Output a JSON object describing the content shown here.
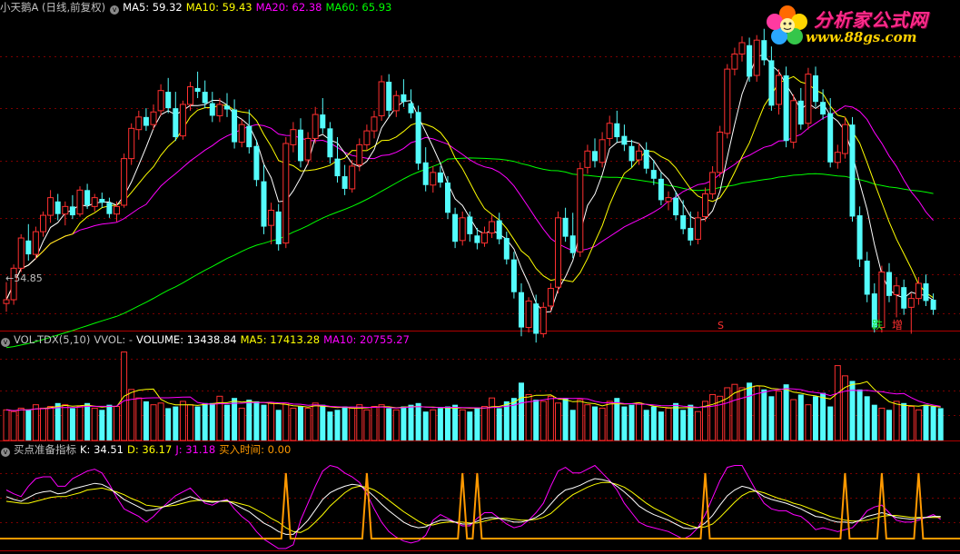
{
  "main_header": {
    "title": "小天鹅A (日线,前复权)",
    "ma5": "MA5: 59.32",
    "ma10": "MA10: 59.43",
    "ma20": "MA20: 62.38",
    "ma60": "MA60: 65.93"
  },
  "vol_header": {
    "name": "VOL-TDX(5,10)",
    "vvol": "VVOL: -",
    "volume": "VOLUME: 13438.84",
    "ma5": "MA5: 17413.28",
    "ma10": "MA10: 20755.27"
  },
  "kdj_header": {
    "name": "买点准备指标",
    "k": "K: 34.51",
    "d": "D: 36.17",
    "j": "J: 31.18",
    "buy": "买入时间: 0.00"
  },
  "low_marker": "54.85",
  "signals": {
    "s_label": "S",
    "die_label": "跌",
    "zeng_label": "增"
  },
  "logo": {
    "title": "分析家公式网",
    "url": "www.88gs.com"
  },
  "colors": {
    "up": "#ff3030",
    "down": "#54fcfc",
    "ma5": "#ffffff",
    "ma10": "#ffff00",
    "ma20": "#ff00ff",
    "ma60": "#00ff00",
    "grid": "#7a0000",
    "buy_line": "#ff9900"
  },
  "chart_data": [
    {
      "type": "candlestick",
      "title": "小天鹅A (日线,前复权)",
      "series_names": [
        "MA5",
        "MA10",
        "MA20",
        "MA60"
      ],
      "annotations": [
        "54.85"
      ],
      "candles": [
        [
          55.5,
          57.2,
          54.85,
          55.8
        ],
        [
          55.8,
          58.6,
          55.4,
          58.3
        ],
        [
          58.3,
          61.0,
          58.0,
          60.7
        ],
        [
          60.5,
          61.8,
          58.9,
          59.4
        ],
        [
          59.4,
          61.6,
          59.0,
          61.2
        ],
        [
          61.2,
          62.8,
          60.8,
          62.5
        ],
        [
          62.5,
          64.5,
          61.9,
          63.9
        ],
        [
          63.6,
          64.2,
          62.1,
          62.6
        ],
        [
          62.6,
          63.6,
          61.7,
          63.2
        ],
        [
          63.2,
          64.1,
          62.2,
          62.5
        ],
        [
          62.6,
          64.8,
          62.4,
          64.5
        ],
        [
          64.5,
          65.0,
          63.0,
          63.3
        ],
        [
          63.2,
          64.2,
          62.8,
          63.9
        ],
        [
          63.8,
          64.3,
          63.1,
          63.5
        ],
        [
          63.5,
          63.9,
          62.3,
          62.6
        ],
        [
          62.6,
          63.6,
          62.0,
          63.2
        ],
        [
          63.3,
          67.4,
          63.1,
          67.0
        ],
        [
          67.0,
          69.8,
          66.5,
          69.4
        ],
        [
          69.3,
          70.8,
          68.5,
          70.3
        ],
        [
          70.3,
          71.0,
          69.2,
          69.6
        ],
        [
          69.7,
          71.3,
          69.3,
          70.7
        ],
        [
          70.8,
          72.9,
          70.4,
          72.4
        ],
        [
          72.3,
          73.4,
          70.6,
          71.0
        ],
        [
          71.0,
          72.3,
          68.4,
          68.7
        ],
        [
          68.8,
          71.6,
          68.5,
          71.3
        ],
        [
          71.3,
          73.1,
          70.8,
          72.7
        ],
        [
          72.6,
          73.9,
          71.8,
          72.3
        ],
        [
          72.3,
          73.2,
          71.0,
          71.4
        ],
        [
          71.4,
          72.3,
          69.9,
          70.4
        ],
        [
          70.4,
          71.8,
          69.9,
          71.3
        ],
        [
          71.2,
          72.2,
          70.3,
          70.9
        ],
        [
          70.9,
          71.7,
          67.8,
          68.3
        ],
        [
          68.3,
          70.1,
          67.9,
          69.7
        ],
        [
          69.6,
          70.9,
          67.4,
          67.9
        ],
        [
          68.0,
          68.5,
          64.8,
          65.3
        ],
        [
          65.2,
          66.5,
          61.0,
          61.6
        ],
        [
          61.7,
          63.5,
          60.2,
          62.9
        ],
        [
          62.8,
          63.4,
          59.7,
          60.2
        ],
        [
          60.3,
          68.7,
          59.9,
          68.2
        ],
        [
          68.1,
          69.9,
          67.5,
          69.3
        ],
        [
          69.3,
          70.2,
          66.3,
          66.8
        ],
        [
          66.9,
          69.1,
          66.5,
          68.6
        ],
        [
          68.6,
          71.1,
          68.2,
          70.5
        ],
        [
          70.5,
          71.8,
          69.0,
          69.4
        ],
        [
          69.4,
          69.9,
          66.6,
          67.1
        ],
        [
          67.0,
          68.7,
          65.1,
          65.6
        ],
        [
          65.6,
          66.5,
          64.1,
          64.6
        ],
        [
          64.6,
          66.9,
          64.3,
          66.4
        ],
        [
          66.5,
          68.6,
          66.0,
          68.1
        ],
        [
          68.1,
          69.7,
          67.7,
          69.2
        ],
        [
          69.2,
          70.8,
          68.6,
          70.3
        ],
        [
          70.4,
          73.6,
          70.0,
          73.1
        ],
        [
          73.1,
          73.7,
          70.3,
          70.8
        ],
        [
          70.8,
          72.4,
          70.3,
          72.0
        ],
        [
          72.1,
          73.3,
          71.1,
          71.5
        ],
        [
          71.4,
          72.5,
          70.2,
          70.6
        ],
        [
          70.7,
          71.2,
          66.1,
          66.6
        ],
        [
          66.7,
          67.9,
          64.4,
          64.9
        ],
        [
          64.9,
          66.4,
          64.3,
          65.9
        ],
        [
          65.9,
          66.4,
          64.7,
          65.1
        ],
        [
          65.1,
          65.6,
          62.2,
          62.7
        ],
        [
          62.6,
          63.1,
          59.9,
          60.4
        ],
        [
          60.5,
          62.8,
          60.1,
          62.3
        ],
        [
          62.4,
          62.8,
          60.4,
          61.0
        ],
        [
          60.9,
          61.5,
          59.8,
          60.3
        ],
        [
          60.3,
          61.6,
          60.0,
          61.1
        ],
        [
          61.1,
          62.5,
          60.7,
          62.0
        ],
        [
          62.1,
          62.7,
          60.2,
          60.6
        ],
        [
          60.7,
          61.2,
          58.6,
          59.0
        ],
        [
          59.0,
          59.6,
          55.9,
          56.4
        ],
        [
          56.4,
          57.1,
          52.9,
          53.6
        ],
        [
          53.6,
          56.0,
          53.2,
          55.7
        ],
        [
          55.5,
          56.2,
          52.4,
          53.1
        ],
        [
          53.1,
          55.6,
          52.8,
          55.2
        ],
        [
          55.3,
          57.1,
          54.9,
          56.7
        ],
        [
          56.8,
          62.8,
          56.3,
          62.3
        ],
        [
          62.3,
          63.1,
          60.4,
          60.8
        ],
        [
          60.9,
          62.7,
          59.1,
          59.5
        ],
        [
          59.6,
          66.7,
          59.2,
          66.2
        ],
        [
          66.3,
          68.1,
          65.8,
          67.6
        ],
        [
          67.6,
          68.6,
          66.3,
          66.8
        ],
        [
          66.7,
          69.1,
          66.3,
          68.5
        ],
        [
          68.6,
          70.4,
          68.0,
          69.8
        ],
        [
          69.8,
          70.8,
          68.3,
          68.7
        ],
        [
          68.8,
          69.7,
          67.6,
          68.1
        ],
        [
          68.0,
          68.5,
          66.3,
          66.8
        ],
        [
          66.9,
          68.2,
          66.5,
          67.6
        ],
        [
          67.7,
          68.3,
          65.8,
          66.2
        ],
        [
          66.1,
          66.9,
          64.9,
          65.4
        ],
        [
          65.4,
          65.9,
          63.3,
          63.7
        ],
        [
          63.6,
          64.4,
          62.9,
          63.9
        ],
        [
          63.9,
          64.4,
          62.1,
          62.5
        ],
        [
          62.5,
          63.7,
          61.0,
          61.4
        ],
        [
          61.5,
          62.8,
          60.1,
          60.5
        ],
        [
          60.6,
          62.8,
          60.2,
          62.3
        ],
        [
          62.4,
          64.7,
          62.0,
          64.2
        ],
        [
          64.2,
          66.4,
          63.8,
          65.9
        ],
        [
          65.9,
          69.6,
          65.5,
          69.1
        ],
        [
          69.0,
          74.5,
          68.6,
          74.1
        ],
        [
          74.1,
          75.8,
          73.6,
          75.3
        ],
        [
          75.3,
          76.7,
          74.7,
          76.2
        ],
        [
          76.0,
          76.6,
          73.1,
          73.5
        ],
        [
          73.6,
          76.8,
          73.1,
          76.4
        ],
        [
          76.4,
          77.3,
          74.4,
          74.8
        ],
        [
          74.8,
          75.9,
          70.8,
          71.2
        ],
        [
          71.3,
          74.1,
          70.5,
          73.6
        ],
        [
          73.6,
          74.3,
          67.9,
          68.4
        ],
        [
          68.3,
          72.1,
          67.8,
          71.6
        ],
        [
          71.6,
          72.6,
          69.3,
          69.7
        ],
        [
          69.8,
          74.2,
          69.3,
          73.7
        ],
        [
          73.6,
          74.3,
          71.1,
          71.5
        ],
        [
          71.5,
          72.5,
          70.1,
          70.5
        ],
        [
          70.6,
          71.8,
          66.3,
          66.7
        ],
        [
          66.7,
          68.1,
          66.2,
          67.5
        ],
        [
          67.4,
          70.3,
          67.0,
          69.7
        ],
        [
          69.7,
          70.3,
          62.0,
          62.4
        ],
        [
          62.5,
          63.2,
          58.4,
          59.0
        ],
        [
          58.9,
          59.6,
          55.6,
          56.2
        ],
        [
          56.3,
          57.1,
          53.2,
          53.6
        ],
        [
          53.6,
          58.5,
          53.2,
          58.0
        ],
        [
          58.0,
          58.7,
          55.6,
          56.1
        ],
        [
          56.2,
          57.6,
          54.4,
          56.9
        ],
        [
          56.8,
          57.4,
          54.6,
          55.1
        ],
        [
          55.2,
          56.3,
          53.1,
          55.9
        ],
        [
          55.9,
          57.6,
          55.4,
          57.1
        ],
        [
          57.1,
          57.8,
          55.3,
          55.7
        ],
        [
          55.8,
          56.3,
          54.6,
          55.0
        ]
      ],
      "ylim": [
        54,
        78
      ]
    },
    {
      "type": "bar",
      "title": "VOL-TDX(5,10)",
      "series_names": [
        "VOLUME",
        "MA5",
        "MA10"
      ],
      "values": [
        18,
        17,
        19,
        18,
        21,
        19,
        20,
        22,
        21,
        19,
        20,
        22,
        19,
        18,
        21,
        20,
        52,
        30,
        25,
        23,
        21,
        22,
        19,
        20,
        23,
        21,
        20,
        22,
        22,
        26,
        21,
        25,
        19,
        24,
        23,
        21,
        22,
        18,
        22,
        19,
        20,
        19,
        22,
        21,
        17,
        18,
        20,
        19,
        21,
        18,
        20,
        21,
        19,
        18,
        20,
        21,
        22,
        17,
        18,
        19,
        20,
        21,
        18,
        17,
        19,
        20,
        25,
        19,
        23,
        25,
        34,
        27,
        24,
        23,
        26,
        22,
        25,
        18,
        24,
        21,
        20,
        19,
        23,
        25,
        20,
        21,
        22,
        18,
        20,
        17,
        19,
        22,
        18,
        21,
        17,
        23,
        27,
        26,
        31,
        33,
        31,
        34,
        32,
        30,
        26,
        29,
        33,
        24,
        27,
        21,
        26,
        28,
        20,
        44,
        38,
        35,
        30,
        26,
        21,
        19,
        18,
        23,
        22,
        20,
        18,
        21,
        20,
        19
      ],
      "ylim": [
        0,
        55
      ]
    },
    {
      "type": "line",
      "title": "买点准备指标",
      "series_names": [
        "K",
        "D",
        "J",
        "买入时间"
      ],
      "k": [
        55,
        52,
        50,
        54,
        58,
        60,
        61,
        58,
        59,
        63,
        65,
        67,
        69,
        68,
        64,
        58,
        52,
        48,
        44,
        40,
        41,
        43,
        46,
        49,
        52,
        55,
        52,
        50,
        49,
        50,
        51,
        47,
        43,
        39,
        33,
        27,
        23,
        18,
        15,
        15,
        22,
        30,
        41,
        52,
        59,
        63,
        66,
        68,
        67,
        62,
        55,
        47,
        40,
        34,
        28,
        24,
        22,
        23,
        27,
        30,
        30,
        28,
        26,
        26,
        29,
        32,
        33,
        32,
        30,
        28,
        28,
        30,
        33,
        38,
        47,
        56,
        62,
        64,
        67,
        71,
        74,
        73,
        71,
        66,
        60,
        53,
        45,
        40,
        36,
        33,
        30,
        26,
        22,
        21,
        22,
        27,
        35,
        46,
        56,
        62,
        66,
        64,
        60,
        55,
        52,
        50,
        48,
        45,
        42,
        38,
        34,
        33,
        30,
        28,
        28,
        27,
        30,
        34,
        36,
        38,
        36,
        33,
        32,
        31,
        32,
        33,
        34,
        34
      ],
      "d": [
        50,
        49,
        48,
        48,
        50,
        52,
        54,
        55,
        55,
        57,
        59,
        62,
        63,
        64,
        62,
        60,
        57,
        53,
        50,
        46,
        45,
        44,
        45,
        46,
        48,
        50,
        51,
        51,
        50,
        50,
        50,
        49,
        47,
        45,
        41,
        37,
        32,
        28,
        22,
        18,
        17,
        21,
        28,
        36,
        45,
        52,
        59,
        64,
        66,
        65,
        62,
        57,
        51,
        45,
        39,
        34,
        29,
        25,
        25,
        27,
        28,
        28,
        28,
        27,
        27,
        29,
        31,
        32,
        32,
        31,
        30,
        30,
        31,
        33,
        37,
        44,
        51,
        57,
        61,
        65,
        68,
        70,
        70,
        68,
        65,
        60,
        54,
        48,
        43,
        39,
        35,
        31,
        27,
        24,
        22,
        23,
        26,
        33,
        41,
        49,
        56,
        60,
        61,
        59,
        56,
        53,
        51,
        48,
        46,
        43,
        40,
        37,
        34,
        32,
        30,
        29,
        29,
        30,
        32,
        34,
        35,
        35,
        34,
        33,
        33,
        33,
        33,
        33
      ],
      "j": [
        62,
        58,
        55,
        66,
        74,
        76,
        76,
        66,
        66,
        74,
        78,
        82,
        84,
        80,
        68,
        54,
        42,
        38,
        34,
        28,
        34,
        42,
        49,
        56,
        60,
        64,
        56,
        48,
        46,
        50,
        52,
        42,
        34,
        28,
        18,
        10,
        5,
        0,
        0,
        4,
        30,
        48,
        66,
        82,
        88,
        86,
        80,
        76,
        70,
        58,
        42,
        28,
        18,
        12,
        8,
        6,
        8,
        14,
        30,
        36,
        32,
        28,
        24,
        24,
        32,
        38,
        38,
        32,
        26,
        22,
        24,
        30,
        38,
        48,
        66,
        82,
        86,
        80,
        80,
        84,
        88,
        80,
        72,
        62,
        48,
        38,
        28,
        24,
        22,
        20,
        18,
        14,
        10,
        14,
        22,
        36,
        54,
        72,
        86,
        88,
        88,
        74,
        60,
        48,
        42,
        40,
        40,
        36,
        34,
        28,
        20,
        22,
        20,
        18,
        20,
        22,
        30,
        40,
        44,
        46,
        38,
        30,
        28,
        28,
        30,
        33,
        36,
        31
      ]
    }
  ]
}
